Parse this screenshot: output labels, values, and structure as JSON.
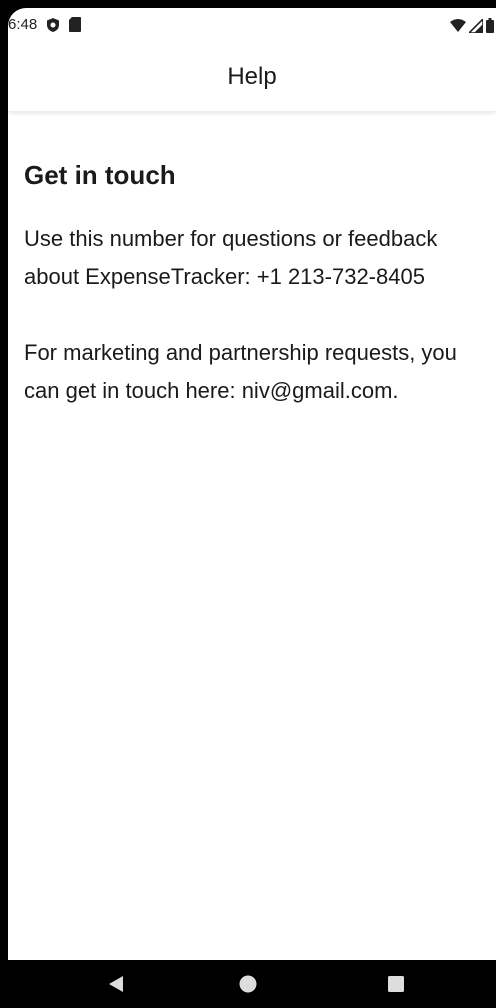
{
  "status_bar": {
    "time": "6:48",
    "left_icons": [
      "shield-icon",
      "sd-card-icon"
    ],
    "right_icons": [
      "wifi-icon",
      "signal-icon",
      "battery-icon"
    ]
  },
  "app_bar": {
    "title": "Help"
  },
  "content": {
    "heading": "Get in touch",
    "paragraph1": "Use this number for questions or feedback about ExpenseTracker: +1 213-732-8405",
    "paragraph2": "For marketing and partnership requests, you can get in touch here: niv@gmail.com."
  },
  "nav_bar": {
    "buttons": [
      "back-icon",
      "home-icon",
      "recents-icon"
    ]
  }
}
